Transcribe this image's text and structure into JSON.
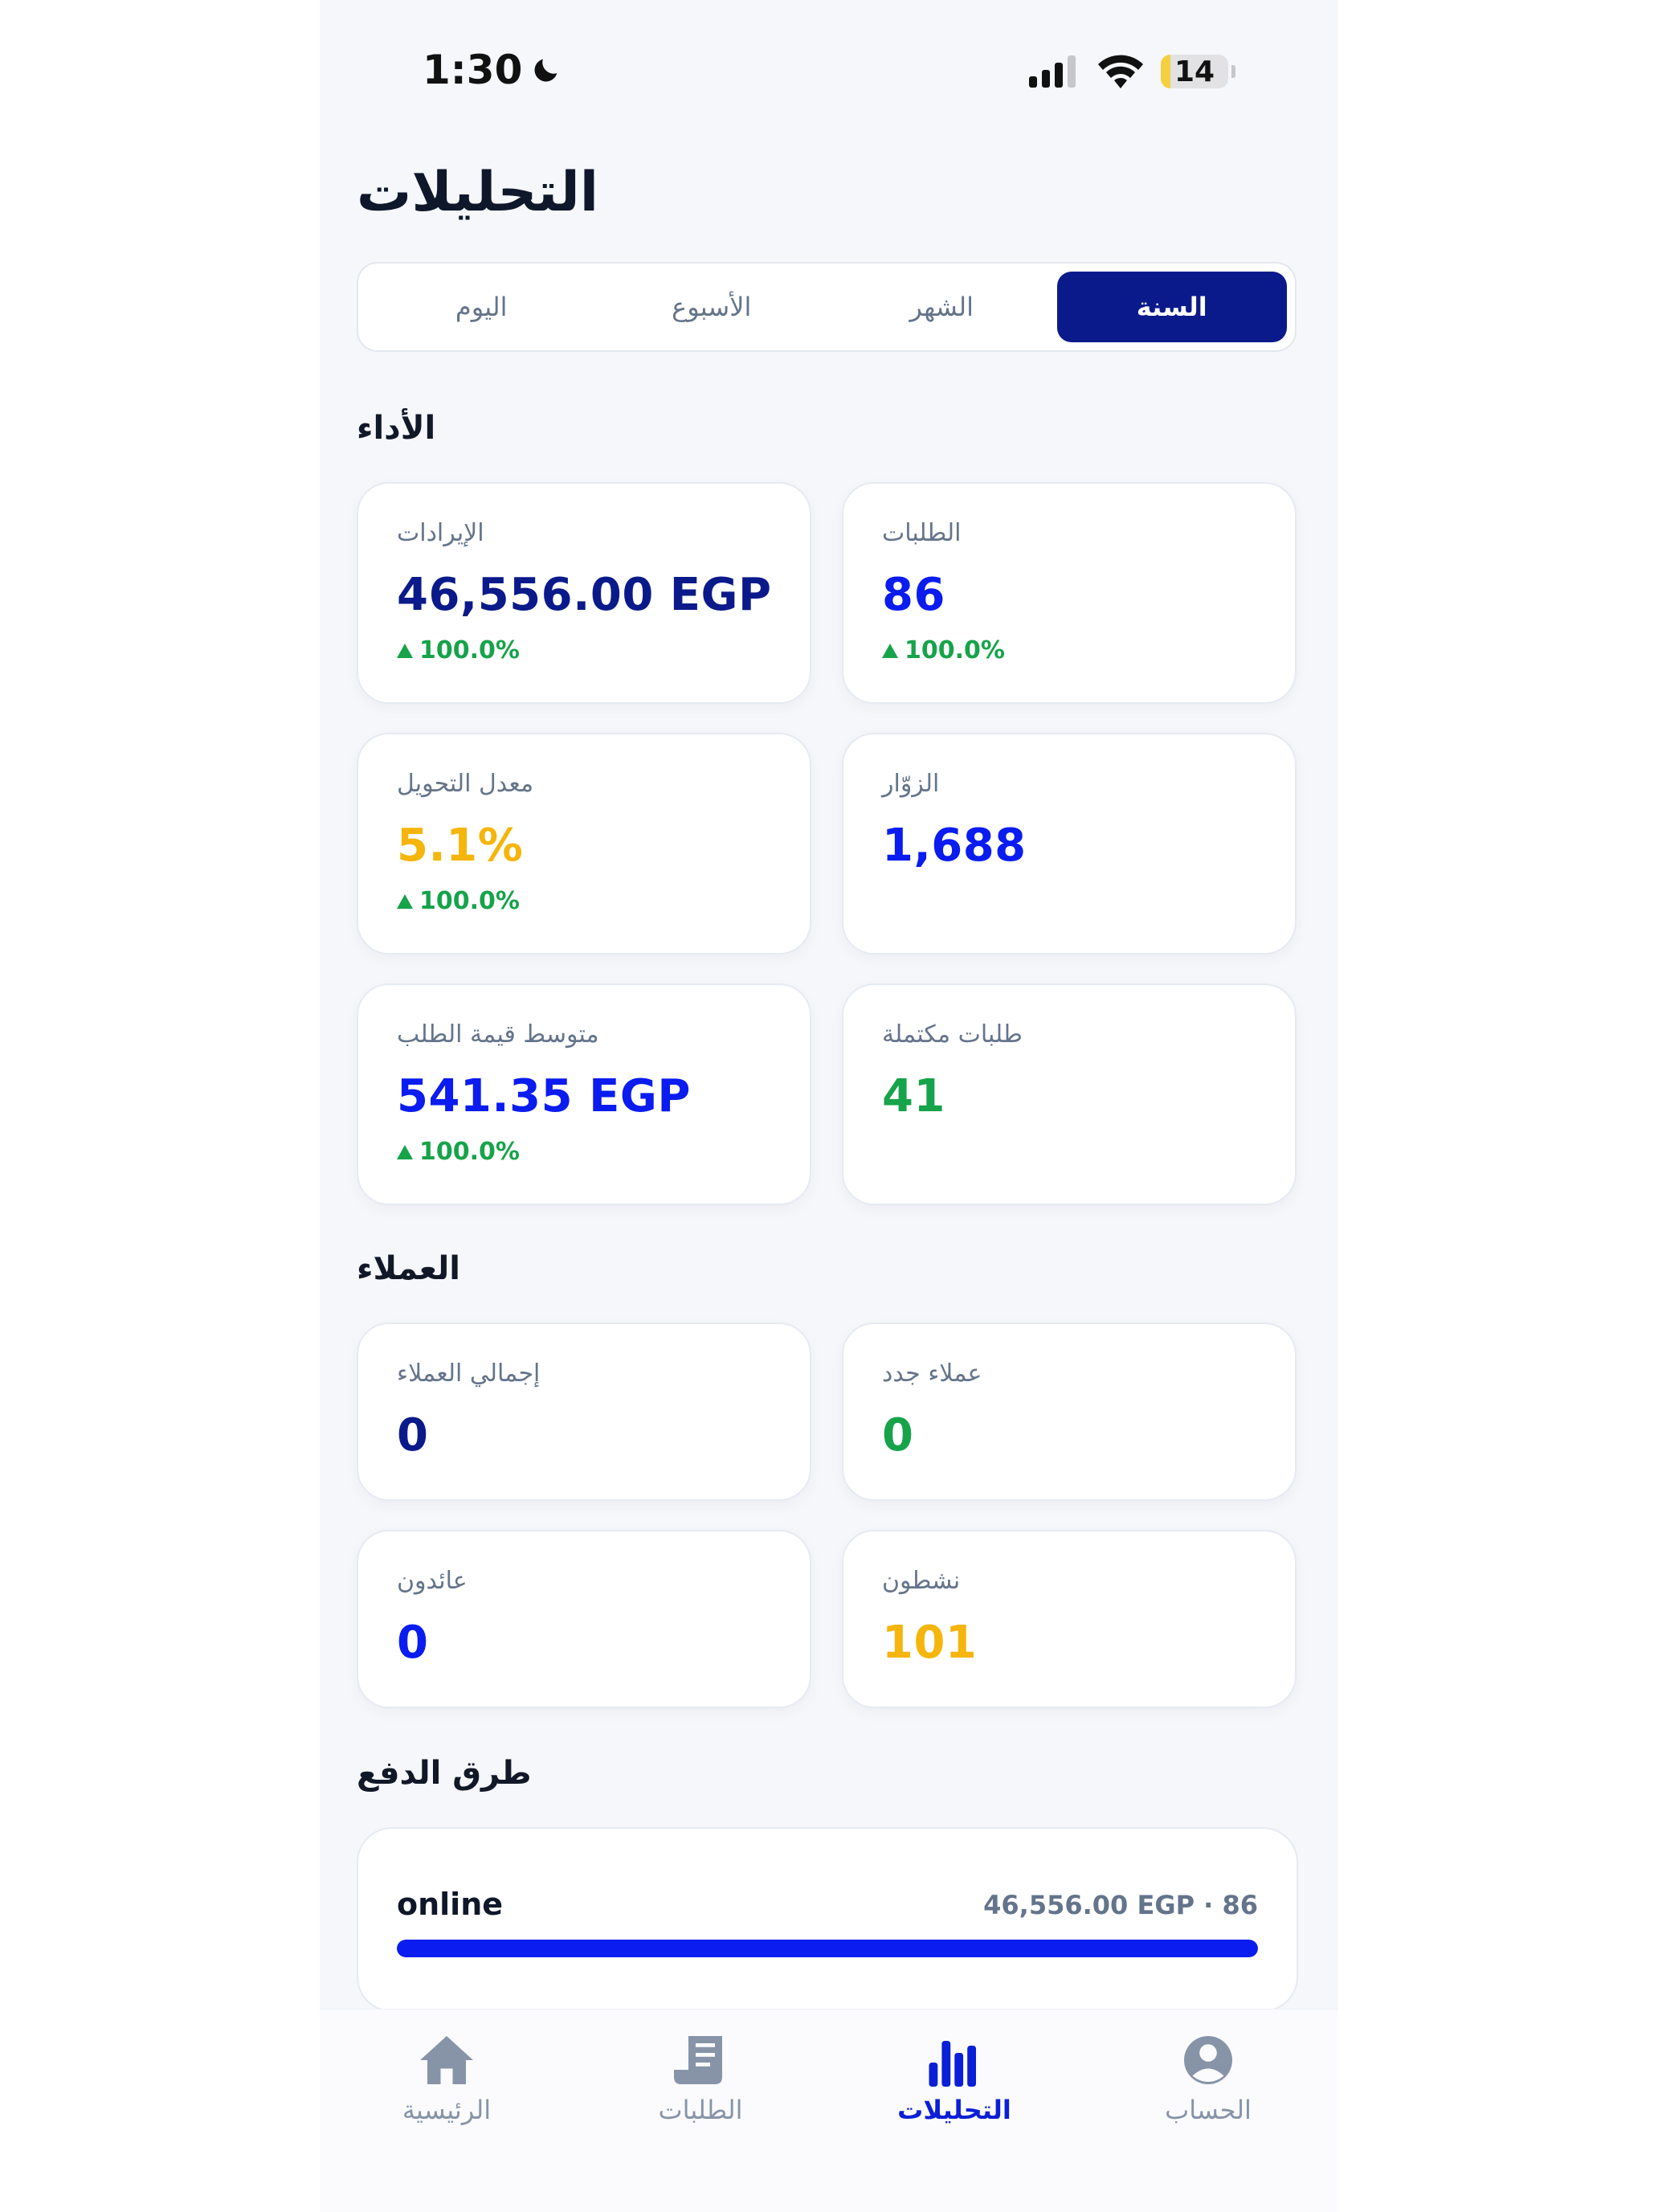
{
  "status": {
    "time": "1:30",
    "battery": "14",
    "battery_level": 0.14
  },
  "header": {
    "title": "التحليلات"
  },
  "segments": [
    {
      "label": "السنة",
      "active": true
    },
    {
      "label": "الشهر",
      "active": false
    },
    {
      "label": "الأسبوع",
      "active": false
    },
    {
      "label": "اليوم",
      "active": false
    }
  ],
  "performance": {
    "title": "الأداء",
    "revenue": {
      "label": "الإيرادات",
      "value": "46,556.00 EGP",
      "delta": "100.0%"
    },
    "orders": {
      "label": "الطلبات",
      "value": "86",
      "delta": "100.0%"
    },
    "conversion": {
      "label": "معدل التحويل",
      "value": "5.1%",
      "delta": "100.0%"
    },
    "visitors": {
      "label": "الزوّار",
      "value": "1,688"
    },
    "avg_order": {
      "label": "متوسط قيمة الطلب",
      "value": "541.35 EGP",
      "delta": "100.0%"
    },
    "completed": {
      "label": "طلبات مكتملة",
      "value": "41"
    }
  },
  "customers": {
    "title": "العملاء",
    "total": {
      "label": "إجمالي العملاء",
      "value": "0"
    },
    "new": {
      "label": "عملاء جدد",
      "value": "0"
    },
    "returning": {
      "label": "عائدون",
      "value": "0"
    },
    "active": {
      "label": "نشطون",
      "value": "101"
    }
  },
  "payments": {
    "title": "طرق الدفع",
    "methods": [
      {
        "name": "online",
        "meta": "46,556.00 EGP · 86",
        "share": 1.0
      }
    ]
  },
  "colors": {
    "navy": "#0b1a8a",
    "blue": "#0a1cf0",
    "green": "#16a34a",
    "amber": "#f5b50a"
  },
  "tabbar": {
    "items": [
      {
        "label": "الرئيسية",
        "icon": "home-icon",
        "active": false
      },
      {
        "label": "الطلبات",
        "icon": "receipt-icon",
        "active": false
      },
      {
        "label": "التحليلات",
        "icon": "bar-chart-icon",
        "active": true
      },
      {
        "label": "الحساب",
        "icon": "user-circle-icon",
        "active": false
      }
    ]
  }
}
